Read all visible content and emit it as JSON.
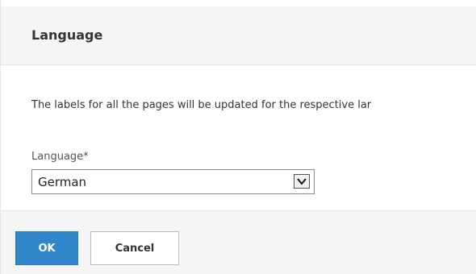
{
  "header": {
    "title": "Language"
  },
  "body": {
    "description": "The labels for all the pages will be updated for the respective lar",
    "language_field": {
      "label": "Language*",
      "selected_value": "German",
      "icon": "chevron-down-icon"
    }
  },
  "footer": {
    "ok_label": "OK",
    "cancel_label": "Cancel"
  },
  "colors": {
    "primary_button": "#2f87c9",
    "header_background": "#f5f5f5"
  }
}
